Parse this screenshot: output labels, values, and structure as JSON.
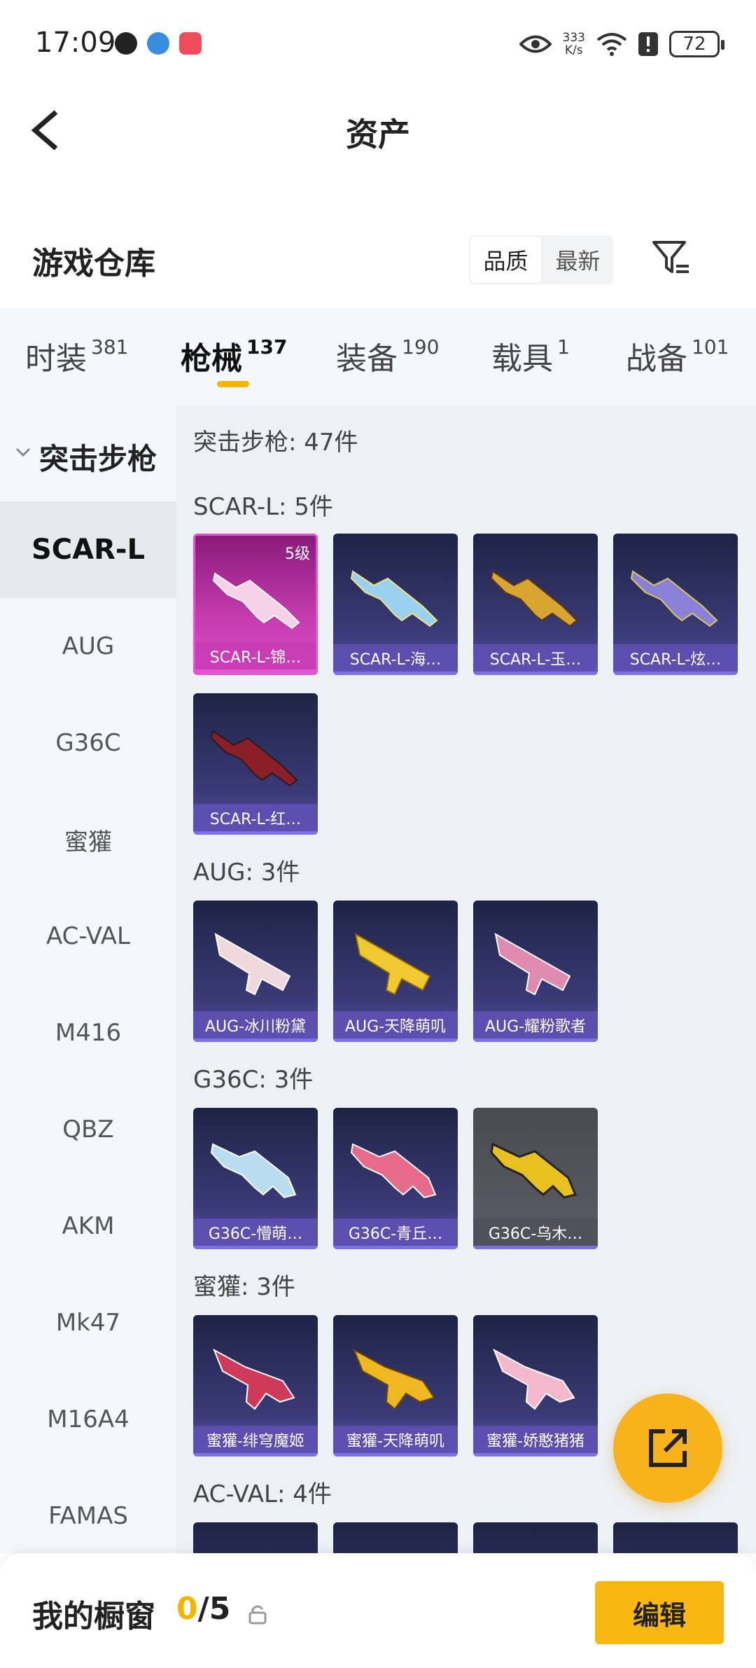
{
  "status_bar": {
    "time": "17:09",
    "net_speed_value": "333",
    "net_speed_unit": "K/s",
    "battery": "72",
    "icons": [
      "qq-icon",
      "browser-icon",
      "shop-icon",
      "eye-icon",
      "wifi-icon",
      "alert-icon",
      "battery-icon"
    ]
  },
  "header": {
    "title": "资产",
    "back_icon": "back-arrow-icon"
  },
  "warehouse": {
    "title": "游戏仓库",
    "sort_options": [
      "品质",
      "最新"
    ],
    "sort_selected": "品质",
    "filter_icon": "filter-icon"
  },
  "tabs": [
    {
      "label": "时装",
      "count": "381"
    },
    {
      "label": "枪械",
      "count": "137"
    },
    {
      "label": "装备",
      "count": "190"
    },
    {
      "label": "载具",
      "count": "1"
    },
    {
      "label": "战备",
      "count": "101"
    }
  ],
  "active_tab": "枪械",
  "sidenav": {
    "category": "突击步枪",
    "items": [
      "SCAR-L",
      "AUG",
      "G36C",
      "蜜獾",
      "AC-VAL",
      "M416",
      "QBZ",
      "AKM",
      "Mk47",
      "M16A4",
      "FAMAS"
    ],
    "active": "SCAR-L"
  },
  "content": {
    "total_label": "突击步枪: 47件",
    "sections": [
      {
        "label": "SCAR-L: 5件",
        "items": [
          {
            "name": "SCAR-L-锦…",
            "badge": "5级",
            "rarity": "pink"
          },
          {
            "name": "SCAR-L-海…",
            "rarity": "purple"
          },
          {
            "name": "SCAR-L-玉…",
            "rarity": "purple"
          },
          {
            "name": "SCAR-L-炫…",
            "rarity": "purple"
          },
          {
            "name": "SCAR-L-红…",
            "rarity": "purple"
          }
        ]
      },
      {
        "label": "AUG: 3件",
        "items": [
          {
            "name": "AUG-冰川粉黛",
            "rarity": "purple"
          },
          {
            "name": "AUG-天降萌叽",
            "rarity": "purple"
          },
          {
            "name": "AUG-耀粉歌者",
            "rarity": "purple"
          }
        ]
      },
      {
        "label": "G36C: 3件",
        "items": [
          {
            "name": "G36C-懵萌…",
            "rarity": "purple"
          },
          {
            "name": "G36C-青丘…",
            "rarity": "purple"
          },
          {
            "name": "G36C-乌木…",
            "rarity": "grey"
          }
        ]
      },
      {
        "label": "蜜獾: 3件",
        "items": [
          {
            "name": "蜜獾-绯穹魔姬",
            "rarity": "purple"
          },
          {
            "name": "蜜獾-天降萌叽",
            "rarity": "purple"
          },
          {
            "name": "蜜獾-娇憨猪猪",
            "rarity": "purple"
          }
        ]
      },
      {
        "label": "AC-VAL: 4件",
        "items": []
      }
    ]
  },
  "fab_icon": "share-icon",
  "bottom_bar": {
    "label": "我的橱窗",
    "count_current": "0",
    "count_total": "/5",
    "lock_icon": "lock-icon",
    "edit_label": "编辑"
  },
  "colors": {
    "accent": "#f4b400",
    "tab_bg": "#f4f7fb",
    "grid_bg": "#edf0f4",
    "card_purple": "#3b3a78",
    "card_pink": "#c43cae"
  }
}
